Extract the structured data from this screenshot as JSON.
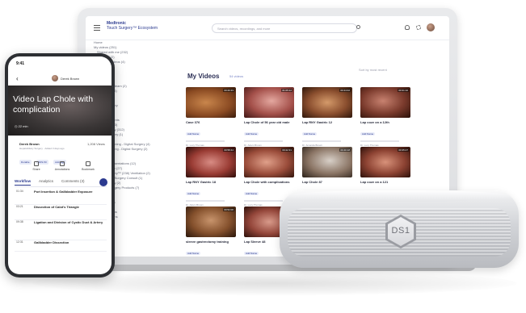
{
  "laptop": {
    "brand_line1": "Medtronic",
    "brand_line2": "Touch Surgery™ Ecosystem",
    "search_placeholder": "Search videos, recordings, and more",
    "nav": [
      "Home",
      "My videos (251)",
      "Shared with me (232)",
      "Archived (2)",
      "Featured videos (4)",
      "",
      "",
      "Hospitals",
      "",
      "Operational team (2)",
      "My groups (6)",
      "Team Alpha",
      "Team Beta",
      "Touch Surgery",
      "",
      "",
      "Hospital Events",
      "Surgeons (33)",
      "Video Library (312)",
      "Digital Surgery (1)",
      "Education",
      "Surgical Training - Digital Surgery (4)",
      "Live Streaming - Digital Surgery (2)",
      "",
      "Reviews",
      "Training Presentations (12)",
      "Laparoscopy (27)",
      "Touch Surgery™ (238) Ventilation (2)",
      "Medtronic® Surgery Consult (1)",
      "Gynaecology (2)",
      "General Surgery Products (7)",
      "",
      "",
      "Conferences",
      "Hospitals",
      "Lap Surgeons",
      "Gyn Surgeons"
    ],
    "main": {
      "title": "My Videos",
      "count": "54 videos",
      "sort": "Sort by most recent"
    },
    "cards": [
      {
        "title": "Case 376",
        "tag": "Add Name",
        "author": "Dr. Lucy Thomas",
        "duration": "00:26:33"
      },
      {
        "title": "Lap Chole of 56 year old male",
        "tag": "Add Name",
        "author": "Dr. Adam Brown",
        "duration": "01:05:12"
      },
      {
        "title": "Lap RNY Gastric 12",
        "tag": "Add Name",
        "author": "Dr. Amanda Brown",
        "duration": "00:44:02"
      },
      {
        "title": "Lap coze on a 12th",
        "tag": "Add Name",
        "author": "Dr. Lucy Thomas",
        "duration": "00:31:10"
      },
      {
        "title": "Lap RNY Gastric 18",
        "tag": "Add Name",
        "author": "Dr. Adam Brown",
        "duration": "00:58:44"
      },
      {
        "title": "Lap Chole with complications",
        "tag": "Add Name",
        "author": "Dr. Lucy Thomas",
        "duration": "00:22:31"
      },
      {
        "title": "Lap Chole 87",
        "tag": "Add Name",
        "author": "Dr. Amanda Brown",
        "duration": "00:40:18"
      },
      {
        "title": "Lap coze on a 121",
        "tag": "Add Name",
        "author": "Dr. Adam Brown",
        "duration": "00:35:27"
      },
      {
        "title": "sleeve gastrectomy training",
        "tag": "Add Name",
        "author": "Dr. Lucy Thomas",
        "duration": "00:52:06"
      },
      {
        "title": "Lap Sleeve 48",
        "tag": "Add Name",
        "author": "Dr. Adam Brown",
        "duration": "00:47:59"
      }
    ]
  },
  "phone": {
    "time": "9:41",
    "user": "Derek Brown",
    "title": "Video Lap Chole with complication",
    "duration": "22 min",
    "author": "Derek Brown",
    "views": "1,208 Views",
    "subtitle": "Hepatobiliary Surgery · Added 3 days ago",
    "chips": [
      "Durable",
      "DDS-50",
      "Add tags"
    ],
    "actions": [
      "Share",
      "Annotations",
      "Bookmark"
    ],
    "tabs": [
      "Workflow",
      "Analytics",
      "Comments (3)"
    ],
    "steps": [
      {
        "time": "01:34",
        "title": "Port Insertion & Gallbladder Exposure"
      },
      {
        "time": "03:21",
        "title": "Dissection of Calot's Triangle"
      },
      {
        "time": "09:38",
        "title": "Ligation and Division of Cystic Duct & Artery"
      },
      {
        "time": "12:31",
        "title": "Gallbladder Dissection"
      }
    ]
  },
  "device": {
    "label": "DS1"
  },
  "colors": {
    "accent": "#2b3a8f",
    "tag_bg": "#e8ebf8"
  }
}
